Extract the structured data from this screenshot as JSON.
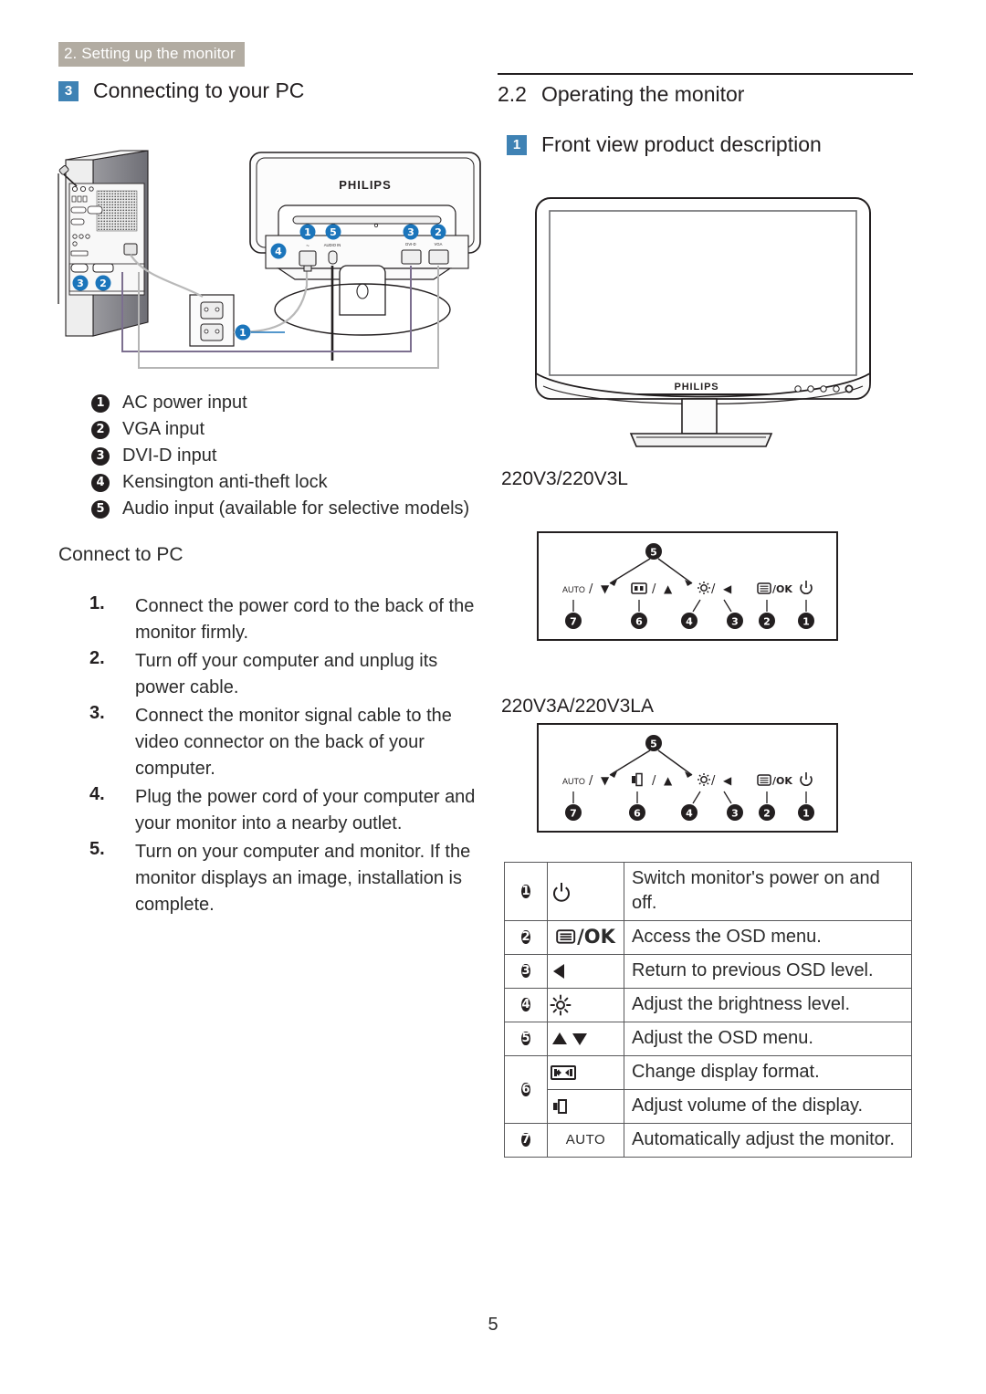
{
  "header": {
    "chapter": "2. Setting up the monitor"
  },
  "left": {
    "section": {
      "badge": "3",
      "title": "Connecting to your PC"
    },
    "diagram": {
      "brand": "PHILIPS",
      "callouts_monitor": [
        "1",
        "5",
        "3",
        "2",
        "4"
      ],
      "callouts_pc": [
        "3",
        "2"
      ],
      "callout_outlet": "1",
      "port_labels": [
        "AUDIO IN",
        "DVI-D",
        "VGA"
      ]
    },
    "ports": [
      {
        "num": "1",
        "label": "AC power input"
      },
      {
        "num": "2",
        "label": "VGA input"
      },
      {
        "num": "3",
        "label": "DVI-D input"
      },
      {
        "num": "4",
        "label": "Kensington anti-theft lock"
      },
      {
        "num": "5",
        "label": "Audio input (available for selective models)"
      }
    ],
    "connect_heading": "Connect to PC",
    "steps": [
      {
        "num": "1.",
        "text": "Connect the power cord to the back of the monitor firmly."
      },
      {
        "num": "2.",
        "text": "Turn off your computer and unplug its power cable."
      },
      {
        "num": "3.",
        "text": "Connect the monitor signal cable to the video connector on the back of your computer."
      },
      {
        "num": "4.",
        "text": "Plug the power cord of your computer and your monitor into a nearby outlet."
      },
      {
        "num": "5.",
        "text": "Turn on your computer and monitor. If the monitor displays an image, installation is complete."
      }
    ]
  },
  "right": {
    "section": {
      "number": "2.2",
      "title": "Operating the monitor"
    },
    "subsection": {
      "badge": "1",
      "title": "Front view product description"
    },
    "front_monitor": {
      "brand": "PHILIPS"
    },
    "models": [
      {
        "label": "220V3/220V3L",
        "buttons": [
          {
            "num": "7",
            "glyph": "AUTO / ▼"
          },
          {
            "num": "6",
            "glyph": "⧉ / ▲"
          },
          {
            "num": "4",
            "glyph": "☀/"
          },
          {
            "num": "3",
            "glyph": "◀"
          },
          {
            "num": "2",
            "glyph": "☰/OK"
          },
          {
            "num": "1",
            "glyph": "⏻"
          }
        ],
        "top_callout": "5"
      },
      {
        "label": "220V3A/220V3LA",
        "buttons": [
          {
            "num": "7",
            "glyph": "AUTO / ▼"
          },
          {
            "num": "6",
            "glyph": "ὐ8 / ▲"
          },
          {
            "num": "4",
            "glyph": "☀/"
          },
          {
            "num": "3",
            "glyph": "◀"
          },
          {
            "num": "2",
            "glyph": "☰/OK"
          },
          {
            "num": "1",
            "glyph": "⏻"
          }
        ],
        "top_callout": "5"
      }
    ],
    "functions": [
      {
        "num": "1",
        "icon": "power-icon",
        "icon_text": "",
        "desc": "Switch monitor's power on and off."
      },
      {
        "num": "2",
        "icon": "osd-menu-icon",
        "icon_text": "/OK",
        "desc": "Access the OSD menu."
      },
      {
        "num": "3",
        "icon": "left-arrow-icon",
        "icon_text": "",
        "desc": "Return to previous OSD level."
      },
      {
        "num": "4",
        "icon": "brightness-icon",
        "icon_text": "",
        "desc": "Adjust the brightness level."
      },
      {
        "num": "5",
        "icon": "up-down-arrow-icon",
        "icon_text": "",
        "desc": "Adjust the OSD menu."
      },
      {
        "num": "6",
        "icon": "display-format-icon",
        "icon_text": "",
        "desc": "Change display format."
      },
      {
        "num": "6b",
        "icon": "volume-icon",
        "icon_text": "",
        "desc": "Adjust volume of the display."
      },
      {
        "num": "7",
        "icon": "auto-icon",
        "icon_text": "AUTO",
        "desc": "Automatically adjust the monitor."
      }
    ]
  },
  "footer": {
    "page": "5"
  },
  "colors": {
    "badge_blue": "#3f82b4",
    "header_taupe": "#b2aca2",
    "callout_blue": "#1b75bb",
    "ink": "#231f20"
  }
}
